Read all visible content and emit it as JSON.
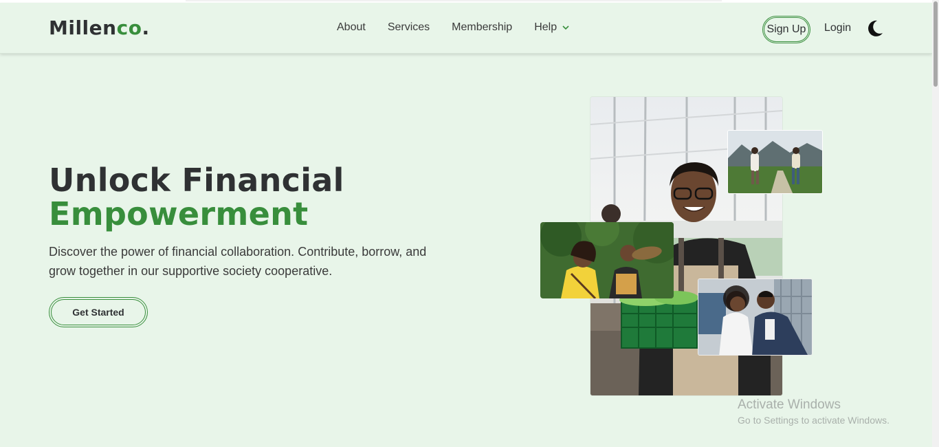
{
  "brand": {
    "name_main": "Millen",
    "name_accent": "co",
    "name_dot": ".",
    "accent_color": "#388e3c"
  },
  "nav": {
    "links": [
      "About",
      "Services",
      "Membership",
      "Help"
    ],
    "signup_label": "Sign Up",
    "login_label": "Login",
    "theme_icon": "moon-icon"
  },
  "hero": {
    "title_line1": "Unlock Financial",
    "title_line2": "Empowerment",
    "description": "Discover the power of financial collaboration. Contribute, borrow, and grow together in our supportive society cooperative.",
    "cta_label": "Get Started"
  },
  "colors": {
    "background": "#e8f5e9",
    "text": "#2f3133",
    "accent": "#388e3c"
  },
  "watermark": {
    "line1": "Activate Windows",
    "line2": "Go to Settings to activate Windows."
  }
}
